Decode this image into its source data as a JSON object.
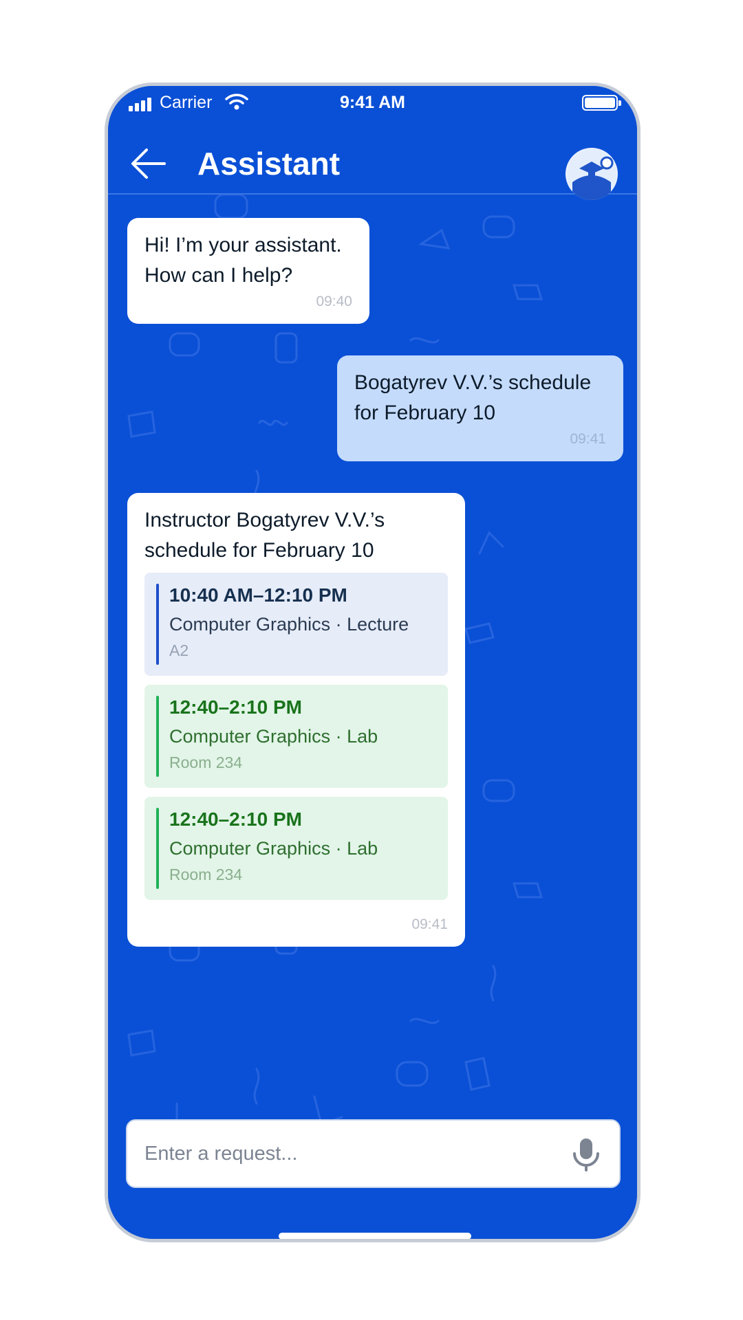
{
  "status_bar": {
    "carrier": "Carrier",
    "time": "9:41 AM"
  },
  "header": {
    "title": "Assistant",
    "back_icon": "arrow-left-icon",
    "avatar_icon": "assistant-avatar-icon"
  },
  "messages": [
    {
      "from": "assistant",
      "text_lines": [
        "Hi! I’m your assistant.",
        "How can I help?"
      ],
      "time": "09:40"
    },
    {
      "from": "user",
      "text_lines": [
        "Bogatyrev V.V.’s schedule",
        "for February 10"
      ],
      "time": "09:41"
    },
    {
      "from": "assistant",
      "text_lines": [
        "Instructor Bogatyrev V.V.’s",
        "schedule for February 10"
      ],
      "time": "09:41",
      "schedule": [
        {
          "time": "10:40 AM–12:10 PM",
          "course": "Computer Graphics · Lecture",
          "room": "A2",
          "kind": "lecture"
        },
        {
          "time": "12:40–2:10 PM",
          "course": "Computer Graphics · Lab",
          "room": "Room 234",
          "kind": "lab"
        },
        {
          "time": "12:40–2:10 PM",
          "course": "Computer Graphics · Lab",
          "room": "Room 234",
          "kind": "lab"
        }
      ]
    }
  ],
  "input": {
    "placeholder": "Enter a request...",
    "value": "",
    "mic_icon": "microphone-icon"
  },
  "colors": {
    "background": "#0a50d6",
    "user_bubble": "#c4dbfb",
    "lecture_bar": "#1b4fcc",
    "lab_bar": "#1fb25a"
  }
}
